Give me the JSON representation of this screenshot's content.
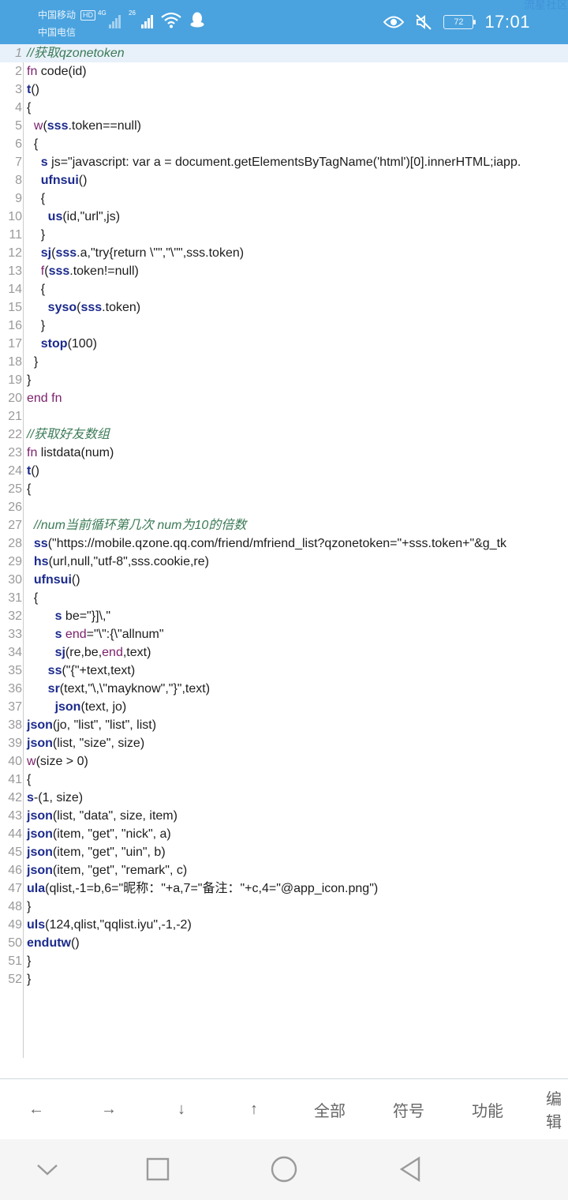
{
  "status": {
    "carrier1": "中国移动",
    "hd": "HD",
    "carrier2": "中国电信",
    "net1": "4G",
    "net2": "26",
    "battery": "72",
    "time": "17:01",
    "watermark": "流星社区"
  },
  "code": [
    {
      "n": "1",
      "parts": [
        {
          "t": "//获取qzonetoken",
          "c": "comment"
        }
      ]
    },
    {
      "n": "2",
      "parts": [
        {
          "t": "fn",
          "c": "kw"
        },
        {
          "t": " code(id)",
          "c": ""
        }
      ]
    },
    {
      "n": "3",
      "parts": [
        {
          "t": "t",
          "c": "fn"
        },
        {
          "t": "()",
          "c": ""
        }
      ]
    },
    {
      "n": "4",
      "parts": [
        {
          "t": "{",
          "c": ""
        }
      ]
    },
    {
      "n": "5",
      "parts": [
        {
          "t": "  w",
          "c": "kw"
        },
        {
          "t": "(",
          "c": ""
        },
        {
          "t": "sss",
          "c": "fn"
        },
        {
          "t": ".token==null)",
          "c": ""
        }
      ]
    },
    {
      "n": "6",
      "parts": [
        {
          "t": "  {",
          "c": ""
        }
      ]
    },
    {
      "n": "7",
      "parts": [
        {
          "t": "    s",
          "c": "fn"
        },
        {
          "t": " js=\"javascript: var a = document.getElementsByTagName('html')[0].innerHTML;iapp.",
          "c": ""
        }
      ]
    },
    {
      "n": "8",
      "parts": [
        {
          "t": "    ufnsui",
          "c": "fn"
        },
        {
          "t": "()",
          "c": ""
        }
      ]
    },
    {
      "n": "9",
      "parts": [
        {
          "t": "    {",
          "c": ""
        }
      ]
    },
    {
      "n": "10",
      "parts": [
        {
          "t": "      us",
          "c": "fn"
        },
        {
          "t": "(id,\"url\",js)",
          "c": ""
        }
      ]
    },
    {
      "n": "11",
      "parts": [
        {
          "t": "    }",
          "c": ""
        }
      ]
    },
    {
      "n": "12",
      "parts": [
        {
          "t": "    sj",
          "c": "fn"
        },
        {
          "t": "(",
          "c": ""
        },
        {
          "t": "sss",
          "c": "fn"
        },
        {
          "t": ".a,\"try{return \\\"\",\"\\\"\",sss.token)",
          "c": ""
        }
      ]
    },
    {
      "n": "13",
      "parts": [
        {
          "t": "    f",
          "c": "kw"
        },
        {
          "t": "(",
          "c": ""
        },
        {
          "t": "sss",
          "c": "fn"
        },
        {
          "t": ".token!=null)",
          "c": ""
        }
      ]
    },
    {
      "n": "14",
      "parts": [
        {
          "t": "    {",
          "c": ""
        }
      ]
    },
    {
      "n": "15",
      "parts": [
        {
          "t": "      syso",
          "c": "fn"
        },
        {
          "t": "(",
          "c": ""
        },
        {
          "t": "sss",
          "c": "fn"
        },
        {
          "t": ".token)",
          "c": ""
        }
      ]
    },
    {
      "n": "16",
      "parts": [
        {
          "t": "    }",
          "c": ""
        }
      ]
    },
    {
      "n": "17",
      "parts": [
        {
          "t": "    stop",
          "c": "fn"
        },
        {
          "t": "(100)",
          "c": ""
        }
      ]
    },
    {
      "n": "18",
      "parts": [
        {
          "t": "  }",
          "c": ""
        }
      ]
    },
    {
      "n": "19",
      "parts": [
        {
          "t": "}",
          "c": ""
        }
      ]
    },
    {
      "n": "20",
      "parts": [
        {
          "t": "end fn",
          "c": "kw"
        }
      ]
    },
    {
      "n": "21",
      "parts": []
    },
    {
      "n": "22",
      "parts": [
        {
          "t": "//获取好友数组",
          "c": "comment"
        }
      ]
    },
    {
      "n": "23",
      "parts": [
        {
          "t": "fn",
          "c": "kw"
        },
        {
          "t": " listdata(num)",
          "c": ""
        }
      ]
    },
    {
      "n": "24",
      "parts": [
        {
          "t": "t",
          "c": "fn"
        },
        {
          "t": "()",
          "c": ""
        }
      ]
    },
    {
      "n": "25",
      "parts": [
        {
          "t": "{",
          "c": ""
        }
      ]
    },
    {
      "n": "26",
      "parts": []
    },
    {
      "n": "27",
      "parts": [
        {
          "t": "  //num当前循环第几次 num为10的倍数",
          "c": "comment"
        }
      ]
    },
    {
      "n": "28",
      "parts": [
        {
          "t": "  ss",
          "c": "fn"
        },
        {
          "t": "(\"https://mobile.qzone.qq.com/friend/mfriend_list?qzonetoken=\"+sss.token+\"&g_tk",
          "c": ""
        }
      ]
    },
    {
      "n": "29",
      "parts": [
        {
          "t": "  hs",
          "c": "fn"
        },
        {
          "t": "(url,null,\"utf-8\",sss.cookie,re)",
          "c": ""
        }
      ]
    },
    {
      "n": "30",
      "parts": [
        {
          "t": "  ufnsui",
          "c": "fn"
        },
        {
          "t": "()",
          "c": ""
        }
      ]
    },
    {
      "n": "31",
      "parts": [
        {
          "t": "  {",
          "c": ""
        }
      ]
    },
    {
      "n": "32",
      "parts": [
        {
          "t": "        s",
          "c": "fn"
        },
        {
          "t": " be=\"}]\\,\"",
          "c": ""
        }
      ]
    },
    {
      "n": "33",
      "parts": [
        {
          "t": "        s",
          "c": "fn"
        },
        {
          "t": " ",
          "c": ""
        },
        {
          "t": "end",
          "c": "kw"
        },
        {
          "t": "=\"\\\":{\\\"allnum\"",
          "c": ""
        }
      ]
    },
    {
      "n": "34",
      "parts": [
        {
          "t": "        sj",
          "c": "fn"
        },
        {
          "t": "(re,be,",
          "c": ""
        },
        {
          "t": "end",
          "c": "kw"
        },
        {
          "t": ",text)",
          "c": ""
        }
      ]
    },
    {
      "n": "35",
      "parts": [
        {
          "t": "      ss",
          "c": "fn"
        },
        {
          "t": "(\"{\"+text,text)",
          "c": ""
        }
      ]
    },
    {
      "n": "36",
      "parts": [
        {
          "t": "      sr",
          "c": "fn"
        },
        {
          "t": "(text,\"\\,\\\"mayknow\",\"}\",text)",
          "c": ""
        }
      ]
    },
    {
      "n": "37",
      "parts": [
        {
          "t": "        json",
          "c": "fn"
        },
        {
          "t": "(text, jo)",
          "c": ""
        }
      ]
    },
    {
      "n": "38",
      "parts": [
        {
          "t": "json",
          "c": "fn"
        },
        {
          "t": "(jo, \"list\", \"list\", list)",
          "c": ""
        }
      ]
    },
    {
      "n": "39",
      "parts": [
        {
          "t": "json",
          "c": "fn"
        },
        {
          "t": "(list, \"size\", size)",
          "c": ""
        }
      ]
    },
    {
      "n": "40",
      "parts": [
        {
          "t": "w",
          "c": "kw"
        },
        {
          "t": "(size > 0)",
          "c": ""
        }
      ]
    },
    {
      "n": "41",
      "parts": [
        {
          "t": "{",
          "c": ""
        }
      ]
    },
    {
      "n": "42",
      "parts": [
        {
          "t": "s",
          "c": "fn"
        },
        {
          "t": "-(1, size)",
          "c": ""
        }
      ]
    },
    {
      "n": "43",
      "parts": [
        {
          "t": "json",
          "c": "fn"
        },
        {
          "t": "(list, \"data\", size, item)",
          "c": ""
        }
      ]
    },
    {
      "n": "44",
      "parts": [
        {
          "t": "json",
          "c": "fn"
        },
        {
          "t": "(item, \"get\", \"nick\", a)",
          "c": ""
        }
      ]
    },
    {
      "n": "45",
      "parts": [
        {
          "t": "json",
          "c": "fn"
        },
        {
          "t": "(item, \"get\", \"uin\", b)",
          "c": ""
        }
      ]
    },
    {
      "n": "46",
      "parts": [
        {
          "t": "json",
          "c": "fn"
        },
        {
          "t": "(item, \"get\", \"remark\", c)",
          "c": ""
        }
      ]
    },
    {
      "n": "47",
      "parts": [
        {
          "t": "ula",
          "c": "fn"
        },
        {
          "t": "(qlist,-1=b,6=\"昵称：\"+a,7=\"备注：\"+c,4=\"@app_icon.png\")",
          "c": ""
        }
      ]
    },
    {
      "n": "48",
      "parts": [
        {
          "t": "}",
          "c": ""
        }
      ]
    },
    {
      "n": "49",
      "parts": [
        {
          "t": "uls",
          "c": "fn"
        },
        {
          "t": "(124,qlist,\"qqlist.iyu\",-1,-2)",
          "c": ""
        }
      ]
    },
    {
      "n": "50",
      "parts": [
        {
          "t": "endutw",
          "c": "fn"
        },
        {
          "t": "()",
          "c": ""
        }
      ]
    },
    {
      "n": "51",
      "parts": [
        {
          "t": "}",
          "c": ""
        }
      ]
    },
    {
      "n": "52",
      "parts": [
        {
          "t": "}",
          "c": ""
        }
      ]
    }
  ],
  "toolbar": {
    "left": "←",
    "right": "→",
    "down": "↓",
    "up": "↑",
    "all": "全部",
    "symbol": "符号",
    "function": "功能",
    "edit": "编辑"
  },
  "nav": {
    "collapse_icon": "chevron-down-icon",
    "recent_icon": "square-icon",
    "home_icon": "circle-icon",
    "back_icon": "triangle-back-icon"
  },
  "colors": {
    "status_bar": "#4aa3df",
    "comment": "#3b7a56",
    "keyword": "#7a1f6b",
    "function": "#1b2a8c"
  }
}
